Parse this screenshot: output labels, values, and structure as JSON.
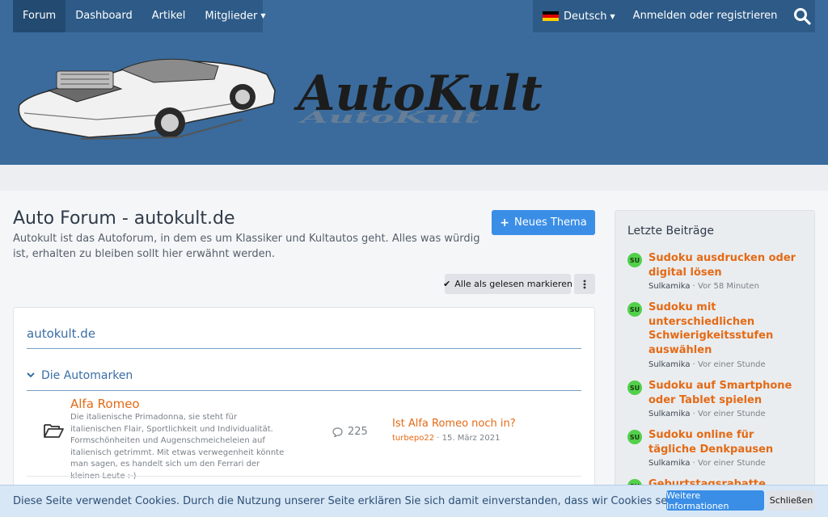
{
  "nav": {
    "tabs": [
      {
        "label": "Forum"
      },
      {
        "label": "Dashboard"
      },
      {
        "label": "Artikel"
      },
      {
        "label": "Mitglieder"
      }
    ],
    "language": "Deutsch",
    "login": "Anmelden oder registrieren",
    "search_icon": "search-icon"
  },
  "header": {
    "logo_text": "AutoKult"
  },
  "main": {
    "title": "Auto Forum - autokult.de",
    "description": "Autokult ist das Autoforum, in dem es um Klassiker und Kultautos geht. Alles was würdig ist, erhalten zu bleiben sollt hier erwähnt werden.",
    "new_thread": "Neues Thema",
    "mark_read": "Alle als gelesen markieren"
  },
  "block": {
    "category": "autokult.de",
    "subcategory": "Die Automarken",
    "forum": {
      "name": "Alfa Romeo",
      "description": "Die italienische Primadonna, sie steht für italienischen Flair, Sportlichkeit und Individualität. Formschönheiten und Augenschmeicheleien auf italienisch getrimmt. Mit etwas verwegenheit könnte man sagen, es handelt sich um den Ferrari der kleinen Leute :-)",
      "threads": "225",
      "latest_title": "Ist Alfa Romeo noch in?",
      "latest_user": "turbepo22",
      "latest_date": "15. März 2021"
    }
  },
  "sidebar": {
    "title": "Letzte Beiträge",
    "posts": [
      {
        "avatar": "SU",
        "title": "Sudoku ausdrucken oder digital lösen",
        "author": "Sulkamika",
        "time": "Vor 58 Minuten"
      },
      {
        "avatar": "SU",
        "title": "Sudoku mit unterschiedlichen Schwierigkeitsstufen auswählen",
        "author": "Sulkamika",
        "time": "Vor einer Stunde"
      },
      {
        "avatar": "SU",
        "title": "Sudoku auf Smartphone oder Tablet spielen",
        "author": "Sulkamika",
        "time": "Vor einer Stunde"
      },
      {
        "avatar": "SU",
        "title": "Sudoku online für tägliche Denkpausen",
        "author": "Sulkamika",
        "time": "Vor einer Stunde"
      },
      {
        "avatar": "SU",
        "title": "Geburtstagsrabatte gezielt",
        "author": "",
        "time": ""
      }
    ]
  },
  "cookie": {
    "text": "Diese Seite verwendet Cookies. Durch die Nutzung unserer Seite erklären Sie sich damit einverstanden, dass wir Cookies setzen.",
    "more": "Weitere Informationen",
    "close": "Schließen"
  },
  "colors": {
    "nav_bg": "#3a6b9c",
    "nav_dark": "#2d5a87",
    "accent_blue": "#3a8ee6",
    "link_orange": "#e46a15",
    "avatar_green": "#52d04a"
  }
}
